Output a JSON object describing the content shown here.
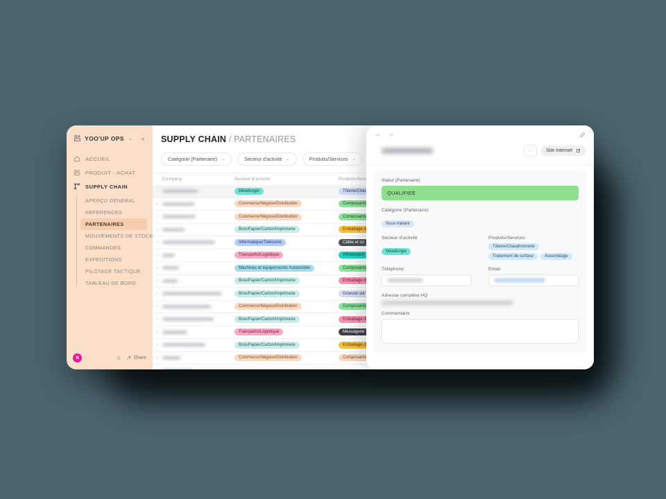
{
  "theme": {
    "background": "#4a646d",
    "sidebar_bg": "#fbdfc8",
    "sidebar_active_bg": "#f7cdae",
    "status_green": "#8ee08e",
    "avatar_color": "#e6199b"
  },
  "sidebar": {
    "brand": {
      "name": "YOO'UP OPS",
      "caret": "⌄",
      "collapse": "«",
      "logo_icon": "workspace-logo-icon"
    },
    "main_items": [
      {
        "label": "ACCUEIL",
        "icon": "home-icon",
        "active": false
      },
      {
        "label": "PRODUIT - ACHAT",
        "icon": "cart-icon",
        "active": false
      },
      {
        "label": "SUPPLY CHAIN",
        "icon": "network-icon",
        "active": true
      }
    ],
    "sub_items": [
      {
        "label": "APERÇU GENERAL",
        "active": false
      },
      {
        "label": "REFERENCES",
        "active": false
      },
      {
        "label": "PARTENAIRES",
        "active": true
      },
      {
        "label": "MOUVEMENTS DE STOCKS",
        "active": false
      },
      {
        "label": "COMMANDES",
        "active": false
      },
      {
        "label": "EXPEDITIONS",
        "active": false
      },
      {
        "label": "PILOTAGE TACTIQUE",
        "active": false
      },
      {
        "label": "TABLEAU DE BORD",
        "active": false
      }
    ],
    "footer": {
      "avatar_initial": "N",
      "bell_icon": "bell-icon",
      "share_label": "Share",
      "share_icon": "share-icon"
    }
  },
  "header": {
    "title_bold": "SUPPLY CHAIN",
    "separator": "/",
    "title_light": "PARTENAIRES"
  },
  "filters": [
    {
      "label": "Catégorie (Partenaire)",
      "caret": "⌄"
    },
    {
      "label": "Secteur d'activité",
      "caret": "⌄"
    },
    {
      "label": "Produits/Services",
      "caret": "⌄"
    }
  ],
  "table": {
    "columns": [
      "Company",
      "Secteur d'activité",
      "Produits/Services"
    ],
    "expand_icon": "›",
    "rows": [
      {
        "name_width": 52,
        "selected": true,
        "secteur": "Métallurgie",
        "secteur_bg": "#6fe3d2",
        "secteur_fg": "#15504a",
        "produit": "Tôlerie/Chau",
        "produit_bg": "#cdd9f5",
        "produit_fg": "#2b3b6b"
      },
      {
        "name_width": 46,
        "selected": false,
        "secteur": "Commerce/Négoce/Distribution",
        "secteur_bg": "#fad9c2",
        "secteur_fg": "#7a4a27",
        "produit": "Composants",
        "produit_bg": "#8fe29a",
        "produit_fg": "#1d4a27"
      },
      {
        "name_width": 48,
        "selected": false,
        "secteur": "Commerce/Négoce/Distribution",
        "secteur_bg": "#fad9c2",
        "secteur_fg": "#7a4a27",
        "produit": "Composants",
        "produit_bg": "#8fe29a",
        "produit_fg": "#1d4a27"
      },
      {
        "name_width": 32,
        "selected": false,
        "secteur": "Bois/Papier/Carton/Imprimerie",
        "secteur_bg": "#c9ece8",
        "secteur_fg": "#1f5a55",
        "produit": "Emballage d",
        "produit_bg": "#fcc03a",
        "produit_fg": "#5a3e00"
      },
      {
        "name_width": 76,
        "selected": false,
        "secteur": "Informatique/Télécoms",
        "secteur_bg": "#b6cdf5",
        "secteur_fg": "#23386e",
        "produit": "Câble et co",
        "produit_bg": "#4a4f52",
        "produit_fg": "#ffffff"
      },
      {
        "name_width": 18,
        "selected": false,
        "secteur": "Transports/Logistique",
        "secteur_bg": "#f9a9c4",
        "secteur_fg": "#6e2040",
        "produit": "Affretement",
        "produit_bg": "#1ed3c0",
        "produit_fg": "#0c4b45"
      },
      {
        "name_width": 24,
        "selected": false,
        "secteur": "Machines et équipements/ Automobile",
        "secteur_bg": "#a8dbe8",
        "secteur_fg": "#1b4c5c",
        "produit": "Composants",
        "produit_bg": "#8fe29a",
        "produit_fg": "#1d4a27"
      },
      {
        "name_width": 22,
        "selected": false,
        "secteur": "Bois/Papier/Carton/Imprimerie",
        "secteur_bg": "#c9ece8",
        "secteur_fg": "#1f5a55",
        "produit": "Emballage d",
        "produit_bg": "#f892b4",
        "produit_fg": "#6e2040"
      },
      {
        "name_width": 86,
        "selected": false,
        "secteur": "Bois/Papier/Carton/Imprimerie",
        "secteur_bg": "#c9ece8",
        "secteur_fg": "#1f5a55",
        "produit": "Gravure sur",
        "produit_bg": "#d7dcf2",
        "produit_fg": "#333a5e"
      },
      {
        "name_width": 70,
        "selected": false,
        "secteur": "Commerce/Négoce/Distribution",
        "secteur_bg": "#fad9c2",
        "secteur_fg": "#7a4a27",
        "produit": "Composants",
        "produit_bg": "#8fe29a",
        "produit_fg": "#1d4a27"
      },
      {
        "name_width": 74,
        "selected": false,
        "secteur": "Bois/Papier/Carton/Imprimerie",
        "secteur_bg": "#c9ece8",
        "secteur_fg": "#1f5a55",
        "produit": "Emballage d",
        "produit_bg": "#f892b4",
        "produit_fg": "#6e2040"
      },
      {
        "name_width": 36,
        "selected": false,
        "secteur": "Transports/Logistique",
        "secteur_bg": "#f9a9c4",
        "secteur_fg": "#6e2040",
        "produit": "Messagerie",
        "produit_bg": "#3d4144",
        "produit_fg": "#ffffff"
      },
      {
        "name_width": 62,
        "selected": false,
        "secteur": "Bois/Papier/Carton/Imprimerie",
        "secteur_bg": "#c9ece8",
        "secteur_fg": "#1f5a55",
        "produit": "Emballage d",
        "produit_bg": "#fcc03a",
        "produit_fg": "#5a3e00"
      },
      {
        "name_width": 26,
        "selected": false,
        "secteur": "Commerce/Négoce/Distribution",
        "secteur_bg": "#fad9c2",
        "secteur_fg": "#7a4a27",
        "produit": "Composants",
        "produit_bg": "#fad9c2",
        "produit_fg": "#7a4a27"
      },
      {
        "name_width": 44,
        "selected": false,
        "secteur": "—",
        "secteur_bg": "",
        "secteur_fg": "",
        "produit": "—",
        "produit_bg": "",
        "produit_fg": ""
      }
    ]
  },
  "panel": {
    "nav_prev_icon": "chevron-up-icon",
    "nav_next_icon": "chevron-down-icon",
    "link_icon": "link-icon",
    "title_redacted": true,
    "dots_label": "···",
    "site_button": {
      "label": "Site Internet",
      "icon": "external-link-icon"
    },
    "fields": {
      "statut_label": "Statut (Partenaire)",
      "statut_value": "QUALIFIEE",
      "categorie_label": "Catégorie (Partenaire)",
      "categorie_value": "Sous-traitant",
      "secteur_label": "Secteur d'activité",
      "secteur_value": "Métallurgie",
      "produits_label": "Produits/Services",
      "produits_values": [
        "Tôlerie/Chaudronnerie",
        "Traitement de surface",
        "Assemblage"
      ],
      "telephone_label": "Téléphone",
      "email_label": "Email",
      "adresse_label": "Adresse complète HQ",
      "commentaire_label": "Commentaire",
      "commentaire_value": ""
    }
  }
}
